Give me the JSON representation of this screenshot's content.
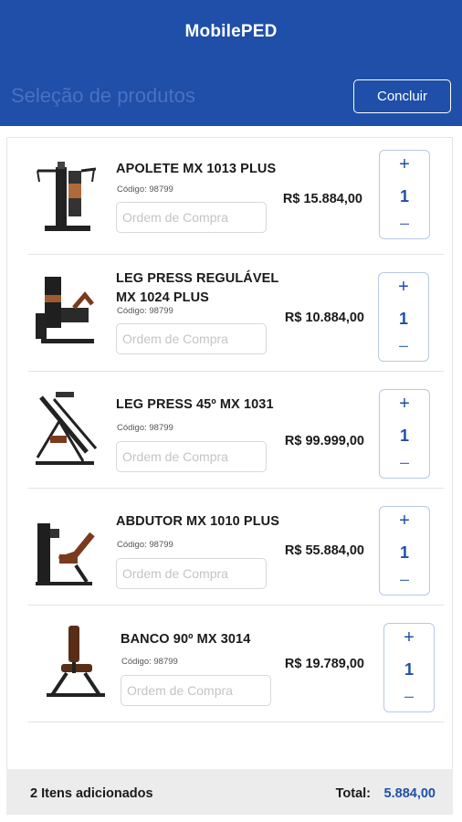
{
  "header": {
    "app_title": "MobilePED",
    "page_title": "Seleção de produtos",
    "concluir_label": "Concluir",
    "bg_color": "#1f4fa8"
  },
  "products": [
    {
      "name": "APOLETE MX 1013 PLUS",
      "code": "Código: 98799",
      "po_placeholder": "Ordem de Compra",
      "price": "R$ 15.884,00",
      "qty": "1",
      "plus": "+",
      "minus": "–"
    },
    {
      "name": "LEG PRESS REGULÁVEL MX 1024 PLUS",
      "code": "Código: 98799",
      "po_placeholder": "Ordem de Compra",
      "price": "R$ 10.884,00",
      "qty": "1",
      "plus": "+",
      "minus": "–"
    },
    {
      "name": "LEG PRESS 45º MX 1031",
      "code": "Código: 98799",
      "po_placeholder": "Ordem de Compra",
      "price": "R$ 99.999,00",
      "qty": "1",
      "plus": "+",
      "minus": "–"
    },
    {
      "name": "ABDUTOR MX 1010 PLUS",
      "code": "Código: 98799",
      "po_placeholder": "Ordem de Compra",
      "price": "R$ 55.884,00",
      "qty": "1",
      "plus": "+",
      "minus": "–"
    },
    {
      "name": "BANCO 90º MX 3014",
      "code": "Código: 98799",
      "po_placeholder": "Ordem de Compra",
      "price": "R$ 19.789,00",
      "qty": "1",
      "plus": "+",
      "minus": "–"
    }
  ],
  "footer": {
    "items_added": "2 Itens adicionados",
    "total_label": "Total:",
    "total_value": "5.884,00"
  }
}
